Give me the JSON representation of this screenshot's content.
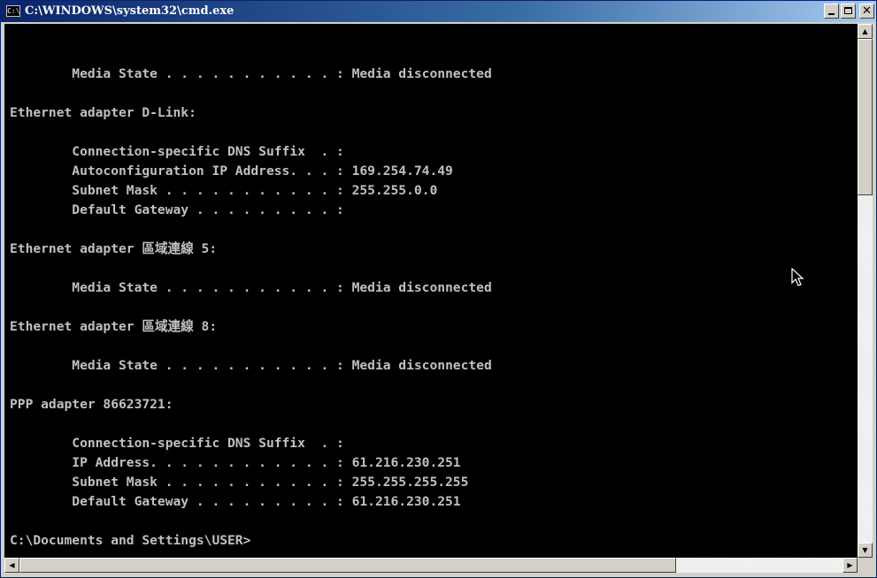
{
  "window": {
    "title": "C:\\WINDOWS\\system32\\cmd.exe",
    "icon_label": "C:\\",
    "minimize_icon": "minimize-icon",
    "maximize_icon": "maximize-icon",
    "close_icon": "close-icon",
    "close_glyph": "✕"
  },
  "colors": {
    "console_background": "#000000",
    "console_text": "#c0c0c0",
    "title_gradient_start": "#0a246a",
    "title_gradient_end": "#a6caf0",
    "chrome": "#d4d0c8"
  },
  "console": {
    "lines": [
      "        Media State . . . . . . . . . . . : Media disconnected",
      "",
      "Ethernet adapter D-Link:",
      "",
      "        Connection-specific DNS Suffix  . :",
      "        Autoconfiguration IP Address. . . : 169.254.74.49",
      "        Subnet Mask . . . . . . . . . . . : 255.255.0.0",
      "        Default Gateway . . . . . . . . . :",
      "",
      "Ethernet adapter 區域連線 5:",
      "",
      "        Media State . . . . . . . . . . . : Media disconnected",
      "",
      "Ethernet adapter 區域連線 8:",
      "",
      "        Media State . . . . . . . . . . . : Media disconnected",
      "",
      "PPP adapter 86623721:",
      "",
      "        Connection-specific DNS Suffix  . :",
      "        IP Address. . . . . . . . . . . . : 61.216.230.251",
      "        Subnet Mask . . . . . . . . . . . : 255.255.255.255",
      "        Default Gateway . . . . . . . . . : 61.216.230.251",
      "",
      "C:\\Documents and Settings\\USER>"
    ]
  },
  "scrollbars": {
    "up_arrow": "▲",
    "down_arrow": "▼",
    "left_arrow": "◀",
    "right_arrow": "▶"
  }
}
